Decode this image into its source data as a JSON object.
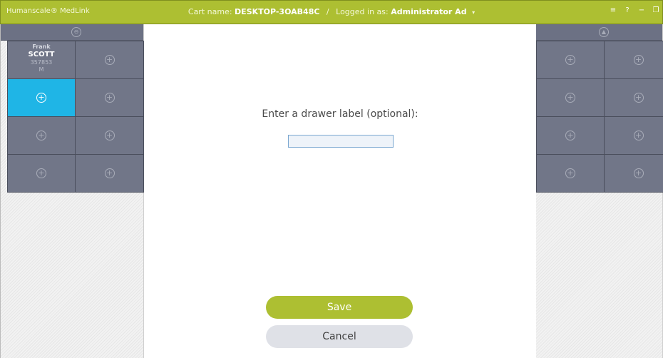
{
  "titlebar": {
    "app_name": "Humanscale® MedLink",
    "cart_label": "Cart name:",
    "cart_name": "DESKTOP-3OAB48C",
    "separator": "/",
    "login_label": "Logged in as:",
    "user": "Administrator Ad",
    "user_caret": "▾",
    "controls": {
      "menu": "≡",
      "help": "?",
      "minimize": "−",
      "restore": "❐"
    }
  },
  "left_panel": {
    "header_icon": "up-arrow-circle-icon",
    "header_glyph": "⊖",
    "patient": {
      "first_name": "Frank",
      "last_name": "SCOTT",
      "mrn": "357853",
      "sex": "M"
    },
    "add_glyph": "+"
  },
  "right_panel": {
    "header_icon": "up-arrow-circle-icon",
    "header_glyph": "▲",
    "add_glyph": "+"
  },
  "dialog": {
    "prompt": "Enter a drawer label (optional):",
    "input_value": "",
    "save_label": "Save",
    "cancel_label": "Cancel"
  },
  "colors": {
    "brand_green": "#adbf32",
    "drawer_gray": "#717688",
    "selected_blue": "#1fb5e6"
  }
}
